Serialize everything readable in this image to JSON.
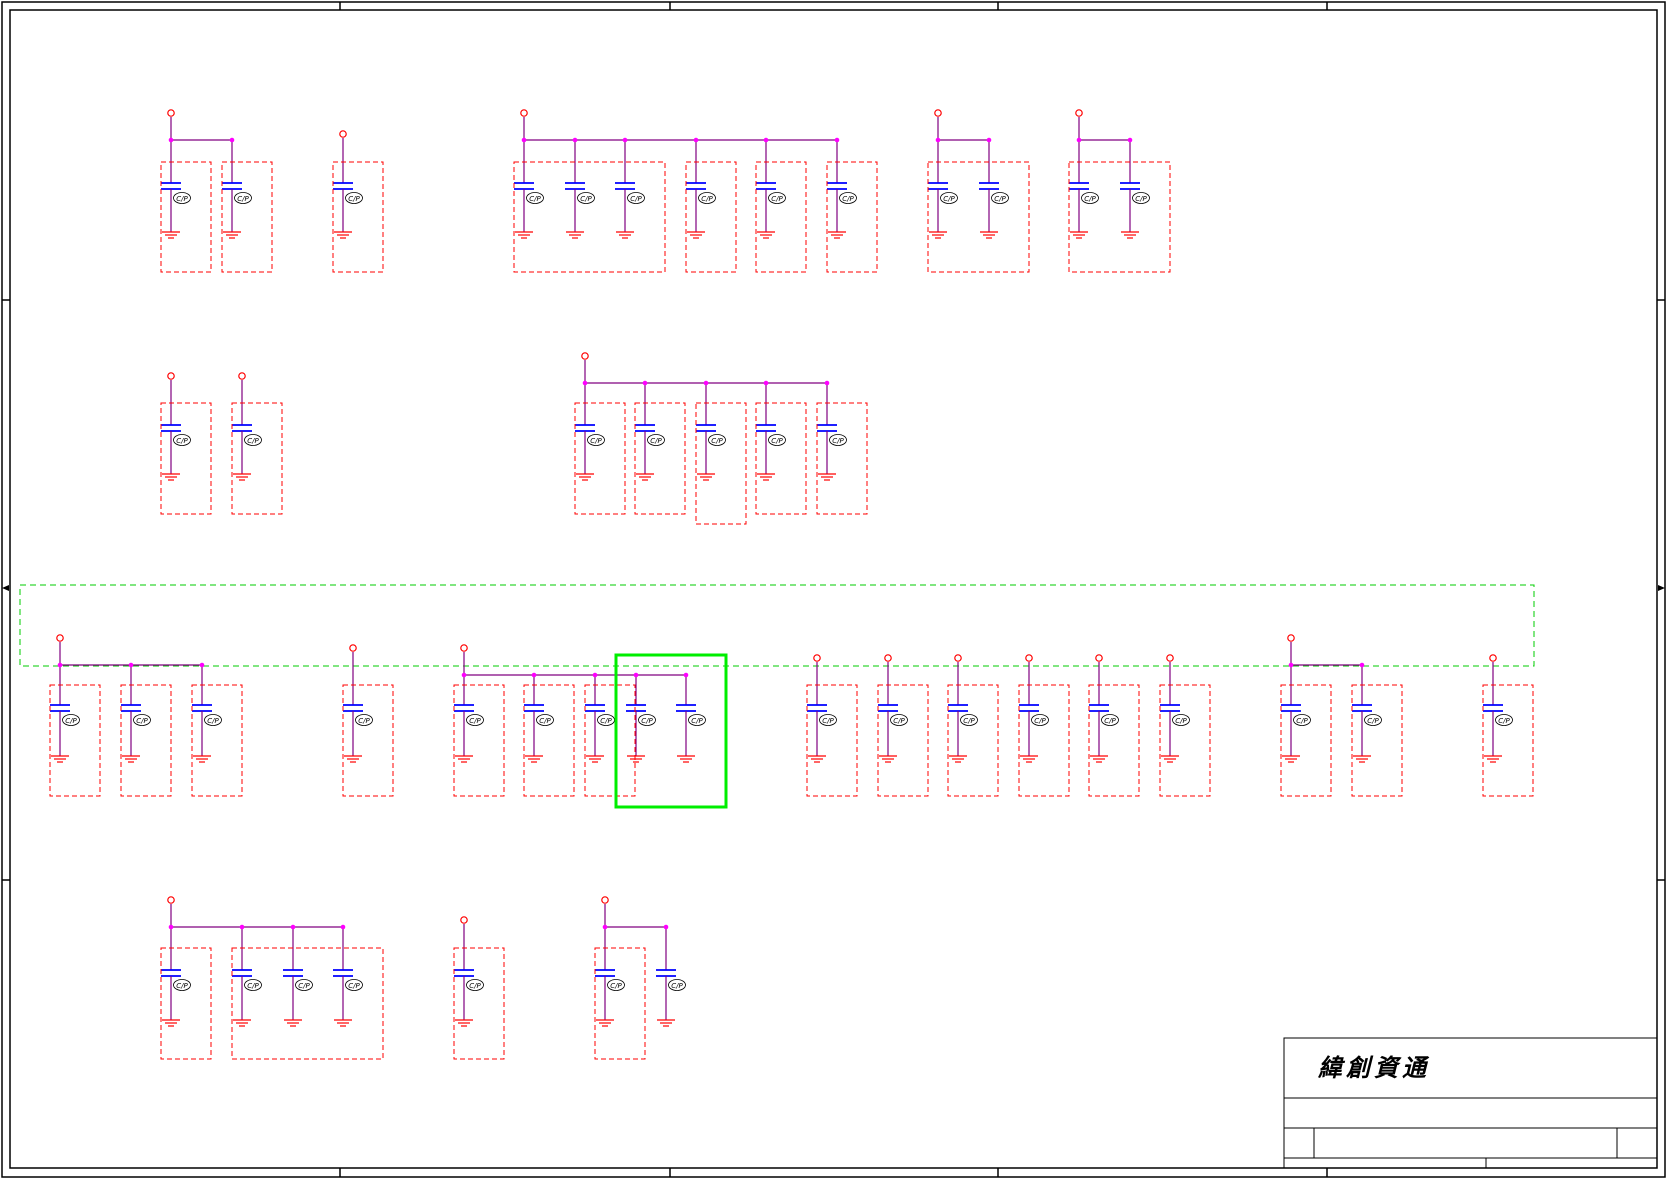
{
  "title_block": {
    "company": "緯創資通"
  },
  "component_label": "C/P",
  "colors": {
    "border": "#000000",
    "wire": "#800080",
    "junction": "#ff00ff",
    "capacitor": "#0000ff",
    "power_pin": "#ff0000",
    "ground": "#ff0000",
    "group_box": "#ff0000",
    "bus_box": "#00cc00",
    "highlight": "#00ee00"
  },
  "capacitor_groups": [
    {
      "caps": 2,
      "rail": "row1",
      "boxes": [
        [
          1
        ],
        [
          1
        ]
      ]
    },
    {
      "caps": 1,
      "rail": "row1",
      "boxes": [
        [
          1
        ]
      ]
    },
    {
      "caps": 6,
      "rail": "row1",
      "boxes": [
        [
          3
        ],
        [
          1
        ],
        [
          1
        ],
        [
          1
        ]
      ]
    },
    {
      "caps": 2,
      "rail": "row1",
      "boxes": [
        [
          2
        ]
      ]
    },
    {
      "caps": 2,
      "rail": "row1",
      "boxes": [
        [
          2
        ]
      ]
    },
    {
      "caps": 2,
      "rail": "row2",
      "boxes": [
        [
          1
        ],
        [
          1
        ]
      ]
    },
    {
      "caps": 5,
      "rail": "row2",
      "boxes": [
        [
          1
        ],
        [
          1
        ],
        [
          1
        ],
        [
          1
        ],
        [
          1
        ]
      ]
    },
    {
      "caps": 3,
      "rail": "row3",
      "boxes": [
        [
          1
        ],
        [
          1
        ],
        [
          1
        ]
      ]
    },
    {
      "caps": 1,
      "rail": "row3",
      "boxes": [
        [
          1
        ]
      ]
    },
    {
      "caps": 5,
      "rail": "row3",
      "boxes": [
        [
          1
        ],
        [
          1
        ],
        [
          1
        ]
      ],
      "highlighted": [
        3,
        4
      ]
    },
    {
      "caps": 6,
      "rail": "row3",
      "boxes": [
        [
          1
        ],
        [
          1
        ],
        [
          1
        ],
        [
          1
        ],
        [
          1
        ],
        [
          1
        ]
      ]
    },
    {
      "caps": 2,
      "rail": "row3",
      "boxes": [
        [
          1
        ],
        [
          1
        ]
      ]
    },
    {
      "caps": 1,
      "rail": "row3",
      "boxes": [
        [
          1
        ]
      ]
    },
    {
      "caps": 4,
      "rail": "row4",
      "boxes": [
        [
          1
        ],
        [
          3
        ]
      ]
    },
    {
      "caps": 1,
      "rail": "row4",
      "boxes": [
        [
          1
        ]
      ]
    },
    {
      "caps": 2,
      "rail": "row4",
      "boxes": [
        [
          1
        ]
      ]
    }
  ]
}
